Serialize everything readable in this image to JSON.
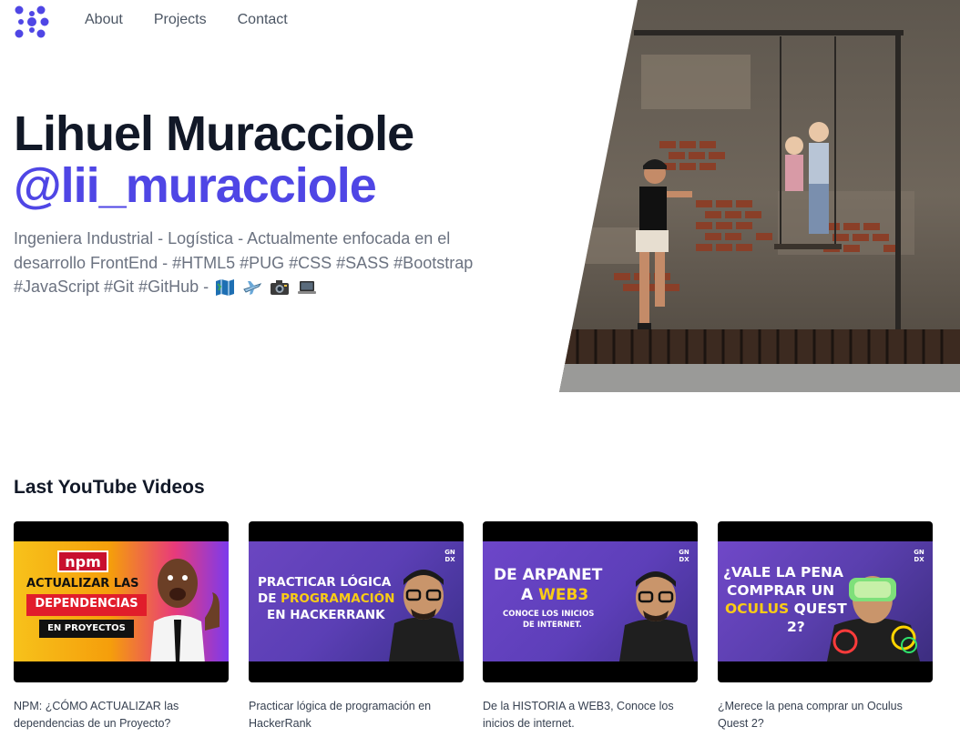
{
  "nav": {
    "logo_icon": "dots-cross-logo-icon",
    "links": [
      "About",
      "Projects",
      "Contact"
    ]
  },
  "hero": {
    "name": "Lihuel Muracciole",
    "handle": "@lii_muracciole",
    "description": "Ingeniera Industrial - Logística - Actualmente enfocada en el desarrollo FrontEnd - #HTML5 #PUG #CSS #SASS #Bootstrap #JavaScript #Git #GitHub -",
    "emojis": [
      "map-icon",
      "airplane-icon",
      "camera-icon",
      "laptop-icon"
    ],
    "photo_icon": "street-art-swing-photo"
  },
  "videos_section": {
    "title": "Last YouTube Videos",
    "videos": [
      {
        "title": "NPM: ¿CÓMO ACTUALIZAR las dependencias de un Proyecto?",
        "thumb": {
          "badge": "npm",
          "line1": "ACTUALIZAR LAS",
          "line2": "DEPENDENCIAS",
          "line3": "EN PROYECTOS"
        }
      },
      {
        "title": "Practicar lógica de programación en HackerRank",
        "thumb": {
          "brand": "GN DX",
          "line1": "PRACTICAR LÓGICA",
          "line2a": "DE ",
          "line2b": "PROGRAMACIÓN",
          "line3": "EN HACKERRANK"
        }
      },
      {
        "title": "De la HISTORIA a WEB3, Conoce los inicios de internet.",
        "thumb": {
          "brand": "GN DX",
          "line1": "DE ARPANET",
          "line2a": "A ",
          "line2b": "WEB3",
          "line3": "CONOCE LOS INICIOS",
          "line4": "DE INTERNET."
        }
      },
      {
        "title": "¿Merece la pena comprar un Oculus Quest 2?",
        "thumb": {
          "brand": "GN DX",
          "line1": "¿VALE LA PENA",
          "line2": "COMPRAR UN",
          "line3a": "OCULUS",
          "line3b": " QUEST",
          "line4": "2?"
        }
      }
    ]
  },
  "colors": {
    "accent": "#4f46e5",
    "text_dark": "#111827",
    "text_muted": "#6b7280"
  }
}
